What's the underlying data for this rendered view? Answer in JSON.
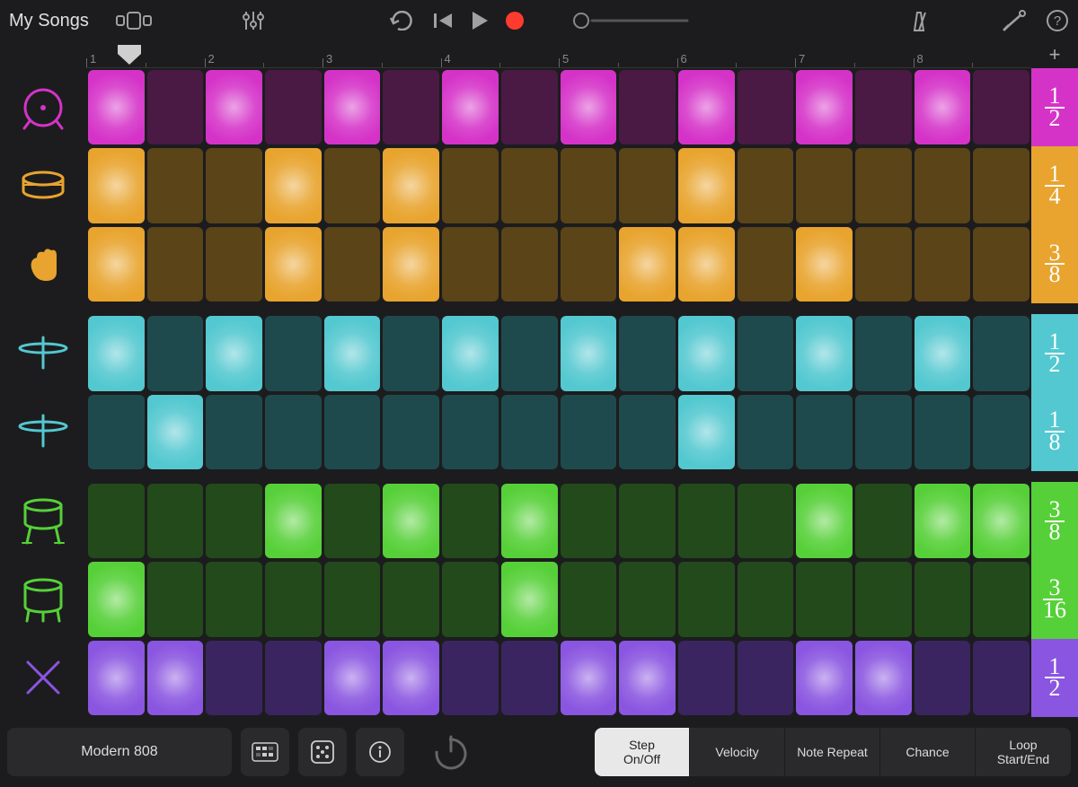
{
  "header": {
    "title": "My Songs"
  },
  "ruler": {
    "bars": [
      "1",
      "2",
      "3",
      "4",
      "5",
      "6",
      "7",
      "8"
    ],
    "add": "+"
  },
  "colors": {
    "magenta_on": "#d533c8",
    "magenta_off": "#4a1a45",
    "amber_on": "#e8a42e",
    "amber_off": "#5a4418",
    "cyan_on": "#53c8d0",
    "cyan_off": "#1f4a4d",
    "green_on": "#56d038",
    "green_off": "#234a1b",
    "purple_on": "#8a55e0",
    "purple_off": "#3a2560"
  },
  "lanes": [
    {
      "icon": "kick",
      "color": "magenta",
      "division": {
        "n": "1",
        "d": "2"
      },
      "steps": [
        1,
        0,
        1,
        0,
        1,
        0,
        1,
        0,
        1,
        0,
        1,
        0,
        1,
        0,
        1,
        0
      ]
    },
    {
      "icon": "snare",
      "color": "amber",
      "division": {
        "n": "1",
        "d": "4"
      },
      "steps": [
        1,
        0,
        0,
        1,
        0,
        1,
        0,
        0,
        0,
        0,
        1,
        0,
        0,
        0,
        0,
        0
      ]
    },
    {
      "icon": "clap",
      "color": "amber",
      "division": {
        "n": "3",
        "d": "8"
      },
      "steps": [
        1,
        0,
        0,
        1,
        0,
        1,
        0,
        0,
        0,
        1,
        1,
        0,
        1,
        0,
        0,
        0
      ]
    },
    {
      "icon": "hihat1",
      "color": "cyan",
      "division": {
        "n": "1",
        "d": "2"
      },
      "steps": [
        1,
        0,
        1,
        0,
        1,
        0,
        1,
        0,
        1,
        0,
        1,
        0,
        1,
        0,
        1,
        0
      ]
    },
    {
      "icon": "hihat2",
      "color": "cyan",
      "division": {
        "n": "1",
        "d": "8"
      },
      "steps": [
        0,
        1,
        0,
        0,
        0,
        0,
        0,
        0,
        0,
        0,
        1,
        0,
        0,
        0,
        0,
        0
      ]
    },
    {
      "icon": "tom",
      "color": "green",
      "division": {
        "n": "3",
        "d": "8"
      },
      "steps": [
        0,
        0,
        0,
        1,
        0,
        1,
        0,
        1,
        0,
        0,
        0,
        0,
        1,
        0,
        1,
        1
      ]
    },
    {
      "icon": "floortom",
      "color": "green",
      "division": {
        "n": "3",
        "d": "16"
      },
      "steps": [
        1,
        0,
        0,
        0,
        0,
        0,
        0,
        1,
        0,
        0,
        0,
        0,
        0,
        0,
        0,
        0
      ]
    },
    {
      "icon": "sticks",
      "color": "purple",
      "division": {
        "n": "1",
        "d": "2"
      },
      "steps": [
        1,
        1,
        0,
        0,
        1,
        1,
        0,
        0,
        1,
        1,
        0,
        0,
        1,
        1,
        0,
        0
      ]
    }
  ],
  "iconColors": {
    "kick": "#d533c8",
    "snare": "#e8a42e",
    "clap": "#e8a42e",
    "hihat1": "#53c8d0",
    "hihat2": "#53c8d0",
    "tom": "#56d038",
    "floortom": "#56d038",
    "sticks": "#8a55e0"
  },
  "bottom": {
    "preset": "Modern 808",
    "modes": [
      {
        "label": "Step\nOn/Off",
        "active": true
      },
      {
        "label": "Velocity",
        "active": false
      },
      {
        "label": "Note Repeat",
        "active": false
      },
      {
        "label": "Chance",
        "active": false
      },
      {
        "label": "Loop\nStart/End",
        "active": false
      }
    ]
  }
}
